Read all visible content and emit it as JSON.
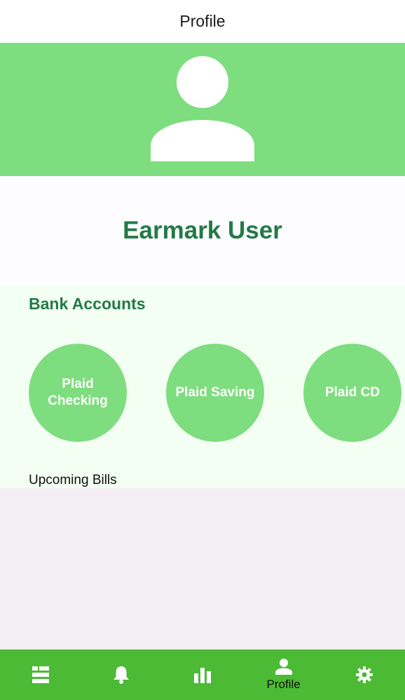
{
  "header": {
    "title": "Profile"
  },
  "profile": {
    "avatar_icon": "user-silhouette-icon",
    "name": "Earmark User"
  },
  "bank_accounts": {
    "title": "Bank Accounts",
    "items": [
      {
        "label": "Plaid Checking"
      },
      {
        "label": "Plaid Saving"
      },
      {
        "label": "Plaid CD"
      }
    ]
  },
  "upcoming_bills": {
    "title": "Upcoming Bills"
  },
  "tabbar": {
    "tabs": [
      {
        "icon": "list-icon",
        "label": ""
      },
      {
        "icon": "bell-icon",
        "label": ""
      },
      {
        "icon": "bar-chart-icon",
        "label": ""
      },
      {
        "icon": "person-icon",
        "label": "Profile"
      },
      {
        "icon": "gear-icon",
        "label": ""
      }
    ]
  },
  "colors": {
    "brand_green": "#7edd7e",
    "tabbar_green": "#4cba35",
    "text_green": "#237a46",
    "panel_bg": "#f3fff3",
    "bills_bg": "#f3eef3"
  }
}
